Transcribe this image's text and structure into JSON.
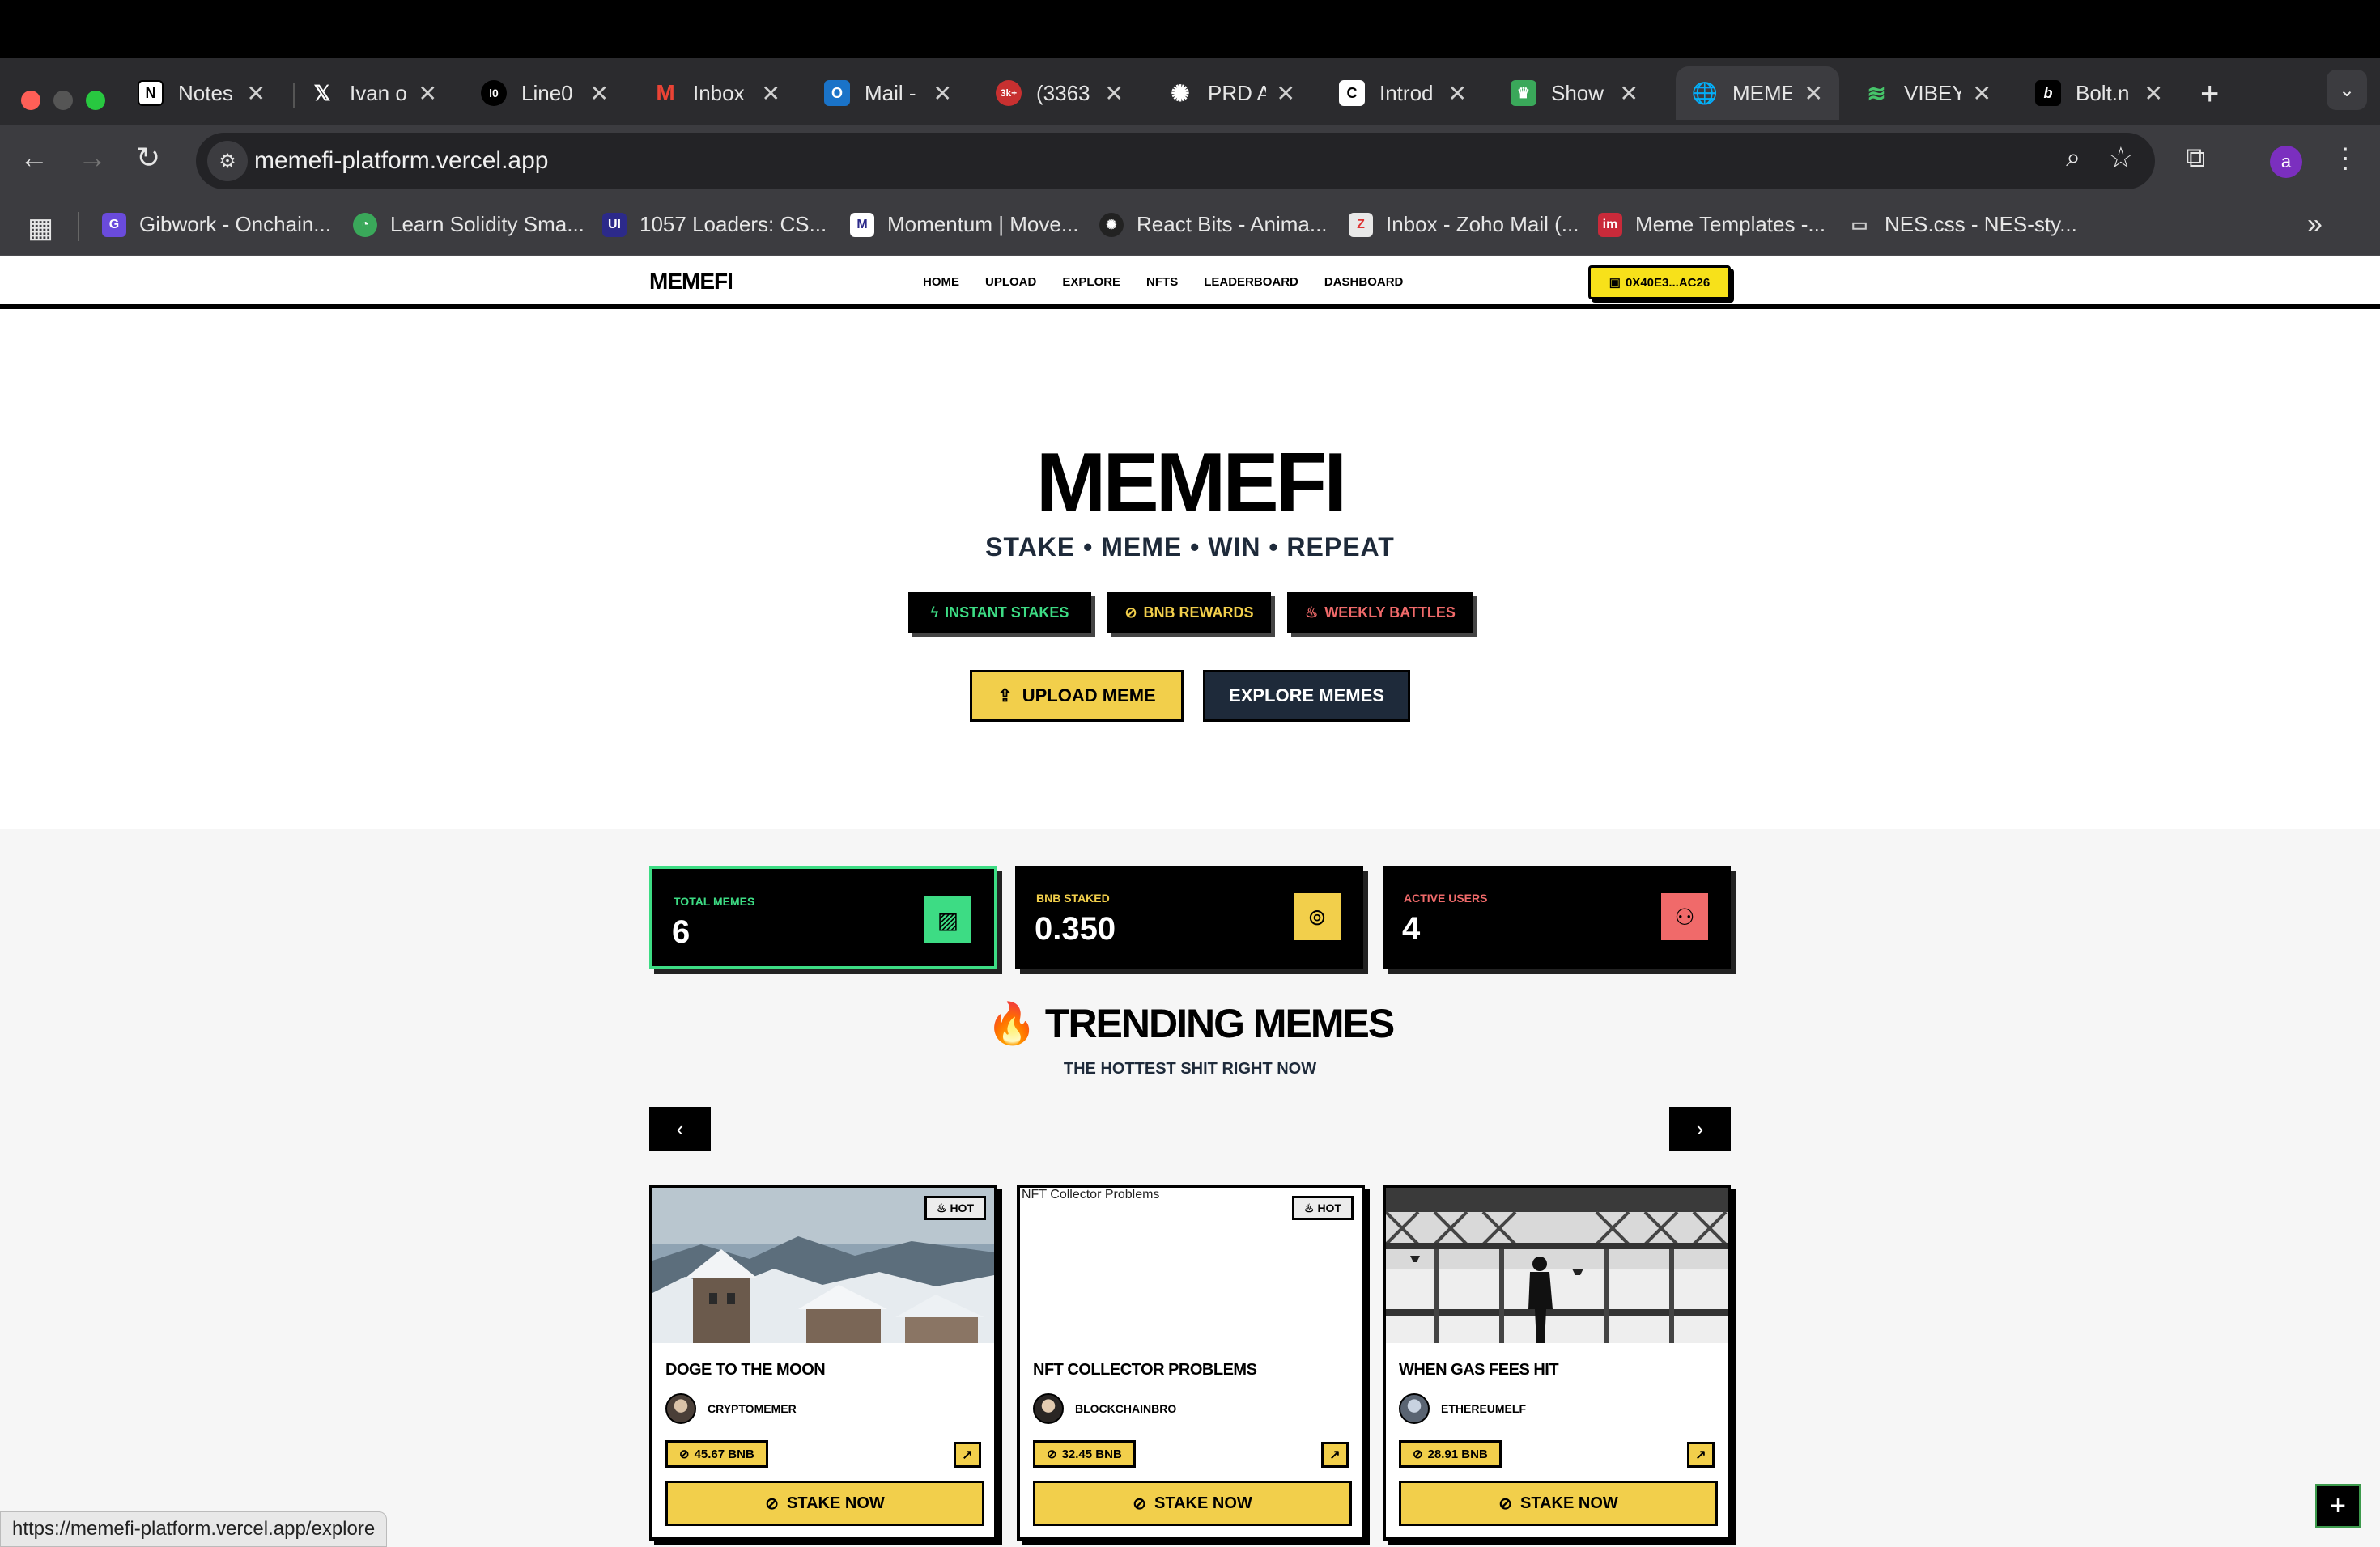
{
  "browser": {
    "tabs": [
      {
        "title": "Notes",
        "icon": "notion-icon"
      },
      {
        "title": "Ivan on",
        "icon": "x-icon"
      },
      {
        "title": "Line0",
        "icon": "line0-icon"
      },
      {
        "title": "Inbox",
        "icon": "gmail-icon"
      },
      {
        "title": "Mail -",
        "icon": "outlook-icon"
      },
      {
        "title": "(3363",
        "icon": "notification-icon",
        "badge": "3k+"
      },
      {
        "title": "PRD A",
        "icon": "openai-icon"
      },
      {
        "title": "Introd",
        "icon": "doc-icon"
      },
      {
        "title": "Show",
        "icon": "crown-icon"
      },
      {
        "title": "MEME",
        "icon": "globe-icon",
        "active": true
      },
      {
        "title": "VIBEY",
        "icon": "waves-icon"
      },
      {
        "title": "Bolt.n",
        "icon": "bolt-icon"
      }
    ],
    "url": "memefi-platform.vercel.app",
    "profile_initial": "a",
    "bookmarks": [
      {
        "label": "Gibwork - Onchain...",
        "color": "#6a4bdc"
      },
      {
        "label": "Learn Solidity Sma...",
        "color": "#3aa85a"
      },
      {
        "label": "1057 Loaders: CS...",
        "color": "#2c2a8a"
      },
      {
        "label": "Momentum | Move...",
        "color": "#ffffff"
      },
      {
        "label": "React Bits - Anima...",
        "color": "#222222"
      },
      {
        "label": "Inbox - Zoho Mail (...",
        "color": "#e8e8e8"
      },
      {
        "label": "Meme Templates -...",
        "color": "#c92a3a"
      },
      {
        "label": "NES.css - NES-sty...",
        "color": "#cccccc"
      }
    ],
    "status_url": "https://memefi-platform.vercel.app/explore"
  },
  "site": {
    "logo": "MEMEFI",
    "nav": [
      "HOME",
      "UPLOAD",
      "EXPLORE",
      "NFTS",
      "LEADERBOARD",
      "DASHBOARD"
    ],
    "wallet": "0X40E3...AC26",
    "hero": {
      "title": "MEMEFI",
      "tagline": "STAKE • MEME • WIN • REPEAT",
      "pills": [
        {
          "label": "INSTANT STAKES",
          "color": "#3ddc84",
          "icon": "bolt-icon"
        },
        {
          "label": "BNB REWARDS",
          "color": "#f2cf4b",
          "icon": "coins-icon"
        },
        {
          "label": "WEEKLY BATTLES",
          "color": "#f06a6a",
          "icon": "flame-icon"
        }
      ],
      "upload_label": "UPLOAD MEME",
      "explore_label": "EXPLORE MEMES"
    },
    "stats": [
      {
        "label": "TOTAL MEMES",
        "value": "6",
        "color": "#3ddc84",
        "icon": "image-icon"
      },
      {
        "label": "BNB STAKED",
        "value": "0.350",
        "color": "#f2cf4b",
        "icon": "coins-icon"
      },
      {
        "label": "ACTIVE USERS",
        "value": "4",
        "color": "#f06a6a",
        "icon": "users-icon"
      }
    ],
    "trending": {
      "title": "TRENDING MEMES",
      "emoji": "🔥",
      "subtitle": "THE HOTTEST SHIT RIGHT NOW",
      "prev": "‹",
      "next": "›"
    },
    "cards": [
      {
        "title": "DOGE TO THE MOON",
        "creator": "CRYPTOMEMER",
        "stake": "45.67 BNB",
        "badge": "HOT",
        "cta": "STAKE NOW",
        "alt": ""
      },
      {
        "title": "NFT COLLECTOR PROBLEMS",
        "creator": "BLOCKCHAINBRO",
        "stake": "32.45 BNB",
        "badge": "HOT",
        "cta": "STAKE NOW",
        "alt": "NFT Collector Problems"
      },
      {
        "title": "WHEN GAS FEES HIT",
        "creator": "ETHEREUMELF",
        "stake": "28.91 BNB",
        "badge": "",
        "cta": "STAKE NOW",
        "alt": ""
      }
    ],
    "fab": "+"
  },
  "colors": {
    "accent_yellow": "#f2cf4b",
    "accent_green": "#3ddc84",
    "accent_red": "#f06a6a",
    "dark_navy": "#1e2a3a"
  }
}
